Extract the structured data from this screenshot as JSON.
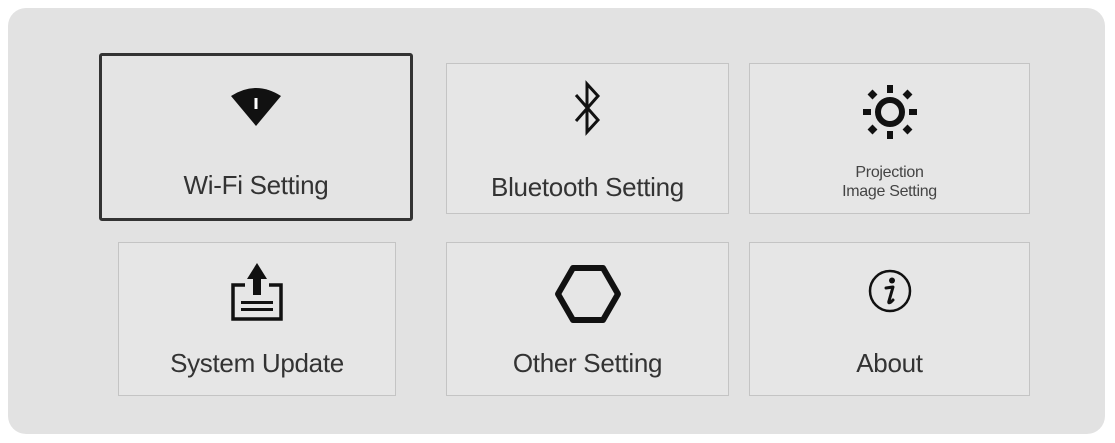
{
  "menu": {
    "selected": "wifi",
    "tiles": {
      "wifi": {
        "label": "Wi-Fi Setting",
        "icon": "wifi-icon"
      },
      "bluetooth": {
        "label": "Bluetooth Setting",
        "icon": "bluetooth-icon"
      },
      "projection": {
        "label_line1": "Projection",
        "label_line2": "Image Setting",
        "icon": "brightness-icon"
      },
      "update": {
        "label": "System Update",
        "icon": "upload-icon"
      },
      "other": {
        "label": "Other Setting",
        "icon": "hexagon-icon"
      },
      "about": {
        "label": "About",
        "icon": "info-icon"
      }
    }
  },
  "colors": {
    "panel_bg": "#e2e2e2",
    "tile_bg": "#e6e6e6",
    "selected_border": "#333333",
    "icon": "#111111"
  }
}
